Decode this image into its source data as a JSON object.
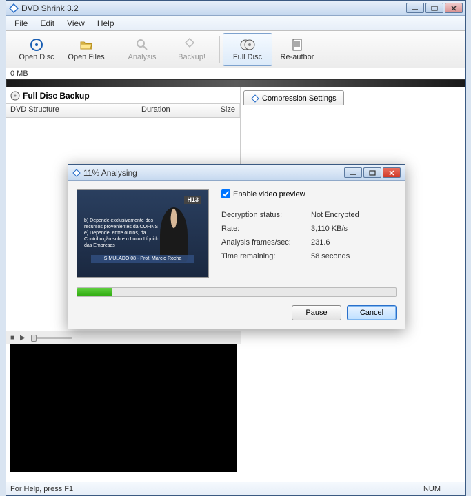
{
  "app": {
    "title": "DVD Shrink 3.2"
  },
  "menu": {
    "file": "File",
    "edit": "Edit",
    "view": "View",
    "help": "Help"
  },
  "toolbar": {
    "open_disc": "Open Disc",
    "open_files": "Open Files",
    "analysis": "Analysis",
    "backup": "Backup!",
    "full_disc": "Full Disc",
    "re_author": "Re-author"
  },
  "sizebar": {
    "label": "0 MB"
  },
  "left_pane": {
    "header": "Full Disc Backup",
    "col_structure": "DVD Structure",
    "col_duration": "Duration",
    "col_size": "Size"
  },
  "right_pane": {
    "tab_compression": "Compression Settings"
  },
  "dialog": {
    "title": "11% Analysing",
    "enable_preview": "Enable video preview",
    "preview_badge": "H13",
    "preview_text": "b) Depende exclusivamente dos recursos provenientes da COFINS\ne) Depende, entre outros, da Contribuição sobre o Lucro Líquido das Empresas",
    "preview_strip": "SIMULADO 08 - Prof. Márcio Rocha",
    "rows": {
      "decryption_label": "Decryption status:",
      "decryption_value": "Not Encrypted",
      "rate_label": "Rate:",
      "rate_value": "3,110 KB/s",
      "frames_label": "Analysis frames/sec:",
      "frames_value": "231.6",
      "time_label": "Time remaining:",
      "time_value": "58 seconds"
    },
    "pause": "Pause",
    "cancel": "Cancel"
  },
  "statusbar": {
    "help": "For Help, press F1",
    "num": "NUM"
  }
}
